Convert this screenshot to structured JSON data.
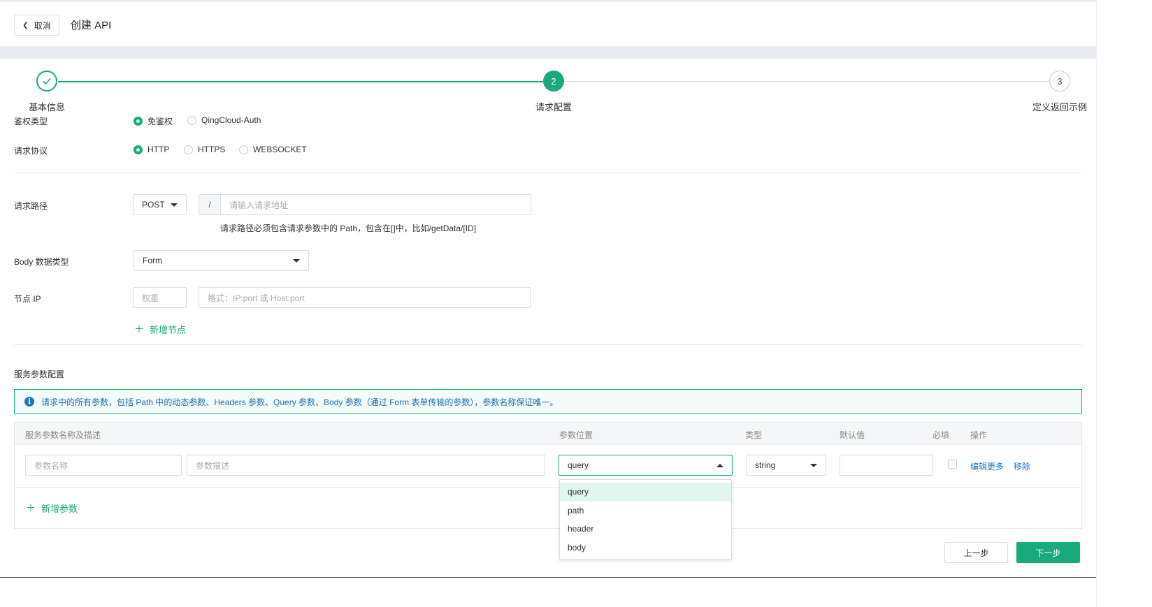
{
  "header": {
    "cancel_label": "取消",
    "title": "创建 API"
  },
  "steps": [
    {
      "num": "",
      "label": "基本信息",
      "state": "done"
    },
    {
      "num": "2",
      "label": "请求配置",
      "state": "active"
    },
    {
      "num": "3",
      "label": "定义返回示例",
      "state": "pending"
    }
  ],
  "auth": {
    "label": "鉴权类型",
    "options": [
      "免鉴权",
      "QingCloud-Auth"
    ],
    "selected": "免鉴权"
  },
  "protocol": {
    "label": "请求协议",
    "options": [
      "HTTP",
      "HTTPS",
      "WEBSOCKET"
    ],
    "selected": "HTTP"
  },
  "path": {
    "label": "请求路径",
    "method": "POST",
    "prefix": "/",
    "placeholder": "请输入请求地址",
    "hint": "请求路径必须包含请求参数中的 Path，包含在[]中，比如/getData/[ID]"
  },
  "body_type": {
    "label": "Body 数据类型",
    "value": "Form"
  },
  "node": {
    "label": "节点 IP",
    "weight_placeholder": "权重",
    "address_placeholder": "格式：IP:port 或 Host:port",
    "add_label": "新增节点"
  },
  "service_params": {
    "section_title": "服务参数配置",
    "info": "请求中的所有参数，包括 Path 中的动态参数、Headers 参数、Query 参数、Body 参数（通过 Form 表单传输的参数），参数名称保证唯一。",
    "columns": [
      "服务参数名称及描述",
      "参数位置",
      "类型",
      "默认值",
      "必填",
      "操作"
    ],
    "row": {
      "name_placeholder": "参数名称",
      "desc_placeholder": "参数描述",
      "location": "query",
      "type": "string",
      "default": "",
      "required": false,
      "edit_more": "编辑更多",
      "remove": "移除"
    },
    "add_label": "新增参数",
    "location_options": [
      "query",
      "path",
      "header",
      "body"
    ],
    "location_selected": "query"
  },
  "footer": {
    "prev_label": "上一步",
    "next_label": "下一步"
  },
  "colors": {
    "accent": "#19a97b",
    "link": "#1a78c2",
    "band": "#e8ecf2"
  }
}
